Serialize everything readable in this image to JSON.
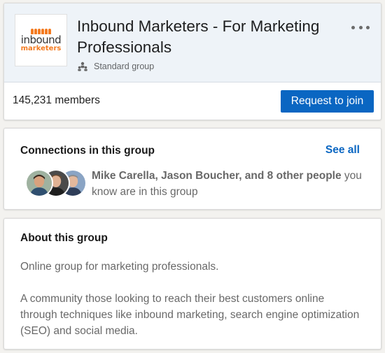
{
  "group": {
    "logo": {
      "line1": "inbound",
      "line2": "marketers",
      "brand_color": "#f47b20"
    },
    "title": "Inbound Marketers - For Marketing Professionals",
    "type_label": "Standard group",
    "type_icon": "group-people-icon",
    "more_icon": "more-horizontal-icon",
    "members": "145,231 members",
    "join_label": "Request to join",
    "accent_color": "#0a66c2"
  },
  "connections": {
    "title": "Connections in this group",
    "see_all_label": "See all",
    "names": "Mike Carella, Jason Boucher, and 8 other people",
    "suffix": "you know are in this group"
  },
  "about": {
    "title": "About this group",
    "paragraphs": [
      "Online group for marketing professionals.",
      "A community those looking to reach their best customers online through techniques like inbound marketing, search engine optimization (SEO) and social media."
    ]
  }
}
